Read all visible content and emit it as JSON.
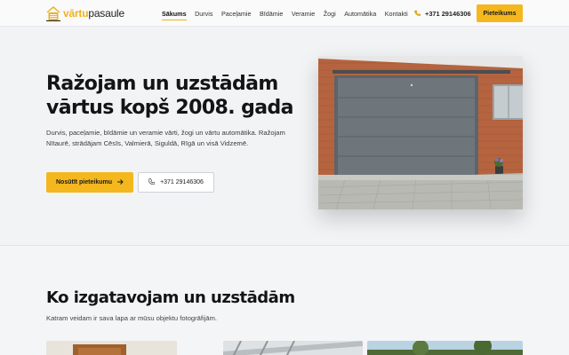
{
  "brand": {
    "part1": "vārtu",
    "part2": "pasaule",
    "accent": "#f4b71e"
  },
  "nav": {
    "items": [
      {
        "label": "Sākums",
        "active": true
      },
      {
        "label": "Durvis"
      },
      {
        "label": "Paceļamie"
      },
      {
        "label": "Bīdāmie"
      },
      {
        "label": "Veramie"
      },
      {
        "label": "Žogi"
      },
      {
        "label": "Automātika"
      },
      {
        "label": "Kontakti"
      }
    ]
  },
  "header": {
    "phone": "+371 29146306",
    "cta": "Pieteikums"
  },
  "hero": {
    "title_line1": "Ražojam un uzstādām",
    "title_line2": "vārtus kopš 2008. gada",
    "text": "Durvis, paceļamie, bīdāmie un veramie vārti, žogi un vārtu automātika. Ražojam Nītaurē, strādājam Cēsīs, Valmierā, Siguldā, Rīgā un visā Vidzemē.",
    "primary_label": "Nosūtīt pieteikumu",
    "secondary_label": "+371 29146306"
  },
  "section": {
    "title": "Ko izgatavojam un uzstādām",
    "subtitle": "Katram veidam ir sava lapa ar mūsu objektu fotogrāfijām."
  }
}
